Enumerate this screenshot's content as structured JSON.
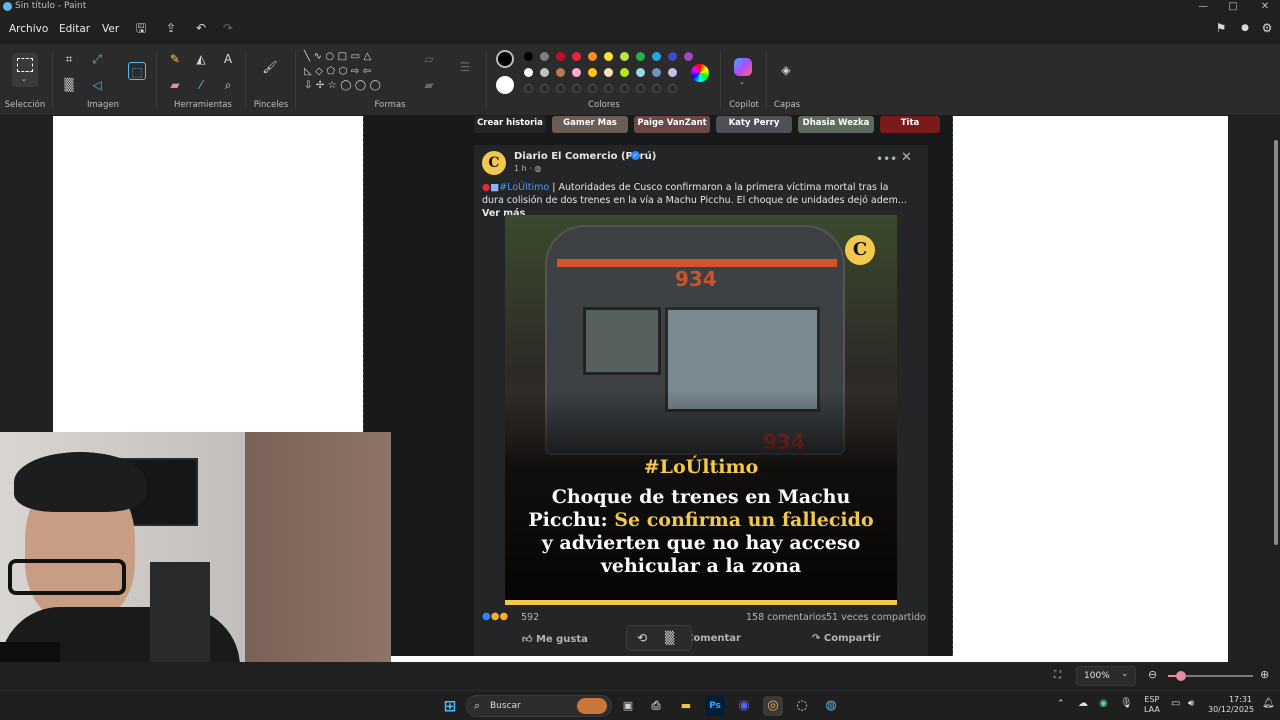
{
  "window": {
    "title": "Sin título - Paint",
    "minimize": "—",
    "maximize": "□",
    "close": "✕"
  },
  "menu": {
    "items": [
      "Archivo",
      "Editar",
      "Ver"
    ]
  },
  "ribbon": {
    "groups": [
      "Selección",
      "Imagen",
      "Herramientas",
      "Pinceles",
      "Formas",
      "Colores",
      "Copilot",
      "Capas"
    ]
  },
  "colors": {
    "row1": [
      "#000000",
      "#7f7f7f",
      "#c3102a",
      "#e8273c",
      "#ff8c26",
      "#ffe434",
      "#b9e63f",
      "#27b34a",
      "#22a7e6",
      "#3f48cc",
      "#a348c0"
    ],
    "row2": [
      "#ffffff",
      "#c3c3c3",
      "#b97a57",
      "#ffaec9",
      "#ffc90e",
      "#efe4b0",
      "#b5e61d",
      "#99d9ea",
      "#7092be",
      "#c8bfe7"
    ]
  },
  "stories": [
    {
      "label": "Crear historia",
      "color": "#242526"
    },
    {
      "label": "Gamer Mas",
      "color": "#6b5c55"
    },
    {
      "label": "Paige VanZant",
      "color": "#6b4747"
    },
    {
      "label": "Katy Perry",
      "color": "#4d5057"
    },
    {
      "label": "Dhasia Wezka",
      "color": "#5d6b5c"
    },
    {
      "label": "Tita",
      "color": "#7a1a1a"
    }
  ],
  "post": {
    "author": "Diario El Comercio (Perú)",
    "time": "1 h · ",
    "hashtag": "#LoÚltimo",
    "body": " | Autoridades de Cusco confirmaron a la primera víctima mortal tras la dura colisión de dos trenes en la vía a Machu Picchu. El choque de unidades dejó adem... ",
    "more": "Ver más",
    "logo": "C",
    "image": {
      "tag": "#LoÚltimo",
      "line1": "Choque de trenes en Machu",
      "line2a": "Picchu: ",
      "line2b": "Se confirma un fallecido",
      "line3": "y advierten que no hay acceso",
      "line4": "vehicular a la zona",
      "train_number": "934"
    },
    "reactions": "592",
    "comments": "158 comentarios",
    "shares": "51 veces compartido",
    "like": "Me gusta",
    "comment": "Comentar",
    "share": "Compartir"
  },
  "status": {
    "zoom": "100%"
  },
  "taskbar": {
    "search": "Buscar",
    "lang1": "ESP",
    "lang2": "LAA",
    "time": "17:31",
    "date": "30/12/2025"
  }
}
